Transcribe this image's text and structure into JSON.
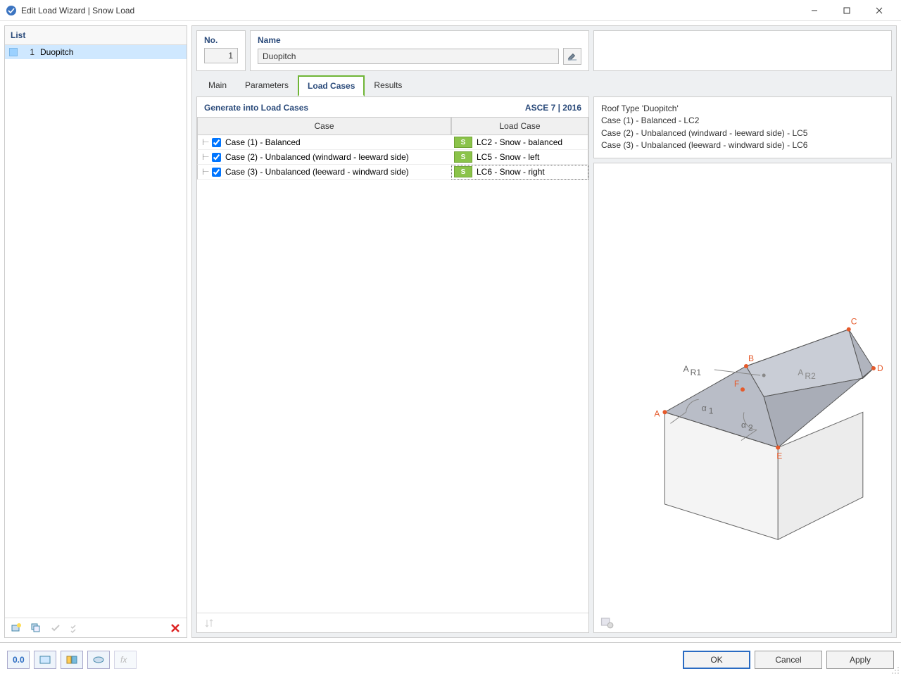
{
  "window": {
    "title": "Edit Load Wizard | Snow Load"
  },
  "left": {
    "header": "List",
    "items": [
      {
        "num": "1",
        "label": "Duopitch"
      }
    ]
  },
  "top": {
    "no_label": "No.",
    "no_value": "1",
    "name_label": "Name",
    "name_value": "Duopitch"
  },
  "tabs": [
    "Main",
    "Parameters",
    "Load Cases",
    "Results"
  ],
  "active_tab": "Load Cases",
  "section": {
    "title": "Generate into Load Cases",
    "spec": "ASCE 7 | 2016",
    "col_case": "Case",
    "col_lc": "Load Case",
    "rows": [
      {
        "checked": true,
        "case": "Case (1) - Balanced",
        "tag": "S",
        "lc": "LC2 - Snow - balanced",
        "selected": false
      },
      {
        "checked": true,
        "case": "Case (2) - Unbalanced (windward - leeward side)",
        "tag": "S",
        "lc": "LC5 - Snow - left",
        "selected": false
      },
      {
        "checked": true,
        "case": "Case (3) - Unbalanced (leeward - windward side)",
        "tag": "S",
        "lc": "LC6 - Snow - right",
        "selected": true
      }
    ]
  },
  "info": [
    "Roof Type 'Duopitch'",
    "Case (1) - Balanced - LC2",
    "Case (2) - Unbalanced (windward - leeward side) - LC5",
    "Case (3) - Unbalanced (leeward - windward side) - LC6"
  ],
  "diagram": {
    "labels": {
      "A": "A",
      "B": "B",
      "C": "C",
      "D": "D",
      "E": "E",
      "F": "F",
      "AR1": "A",
      "AR1sub": "R1",
      "AR2": "A",
      "AR2sub": "R2",
      "a1": "α",
      "a1sub": "1",
      "a2": "α",
      "a2sub": "2"
    }
  },
  "footer": {
    "ok": "OK",
    "cancel": "Cancel",
    "apply": "Apply"
  }
}
